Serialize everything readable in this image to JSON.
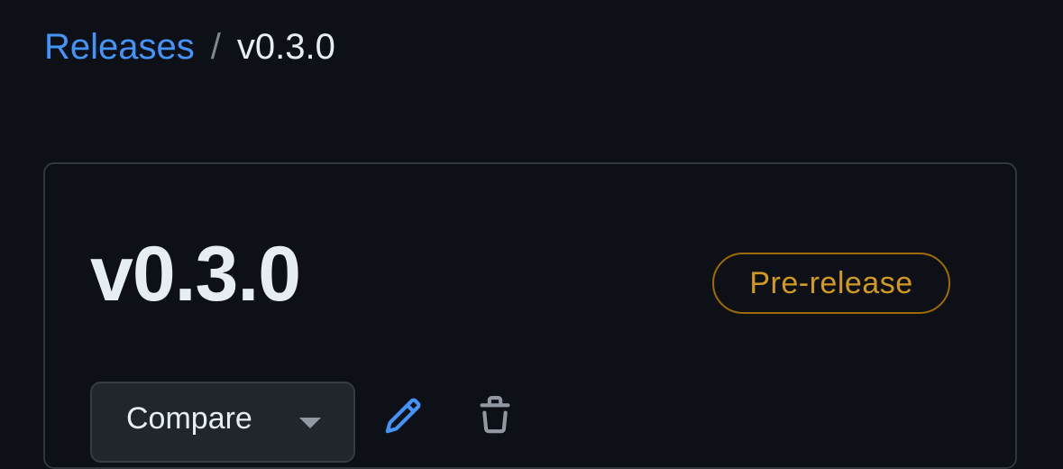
{
  "breadcrumb": {
    "link_label": "Releases",
    "separator": "/",
    "current": "v0.3.0"
  },
  "release": {
    "title": "v0.3.0",
    "badge": "Pre-release",
    "compare_label": "Compare"
  },
  "icons": {
    "caret": "triangle-down-icon",
    "edit": "pencil-icon",
    "delete": "trash-icon"
  },
  "colors": {
    "background": "#0d1117",
    "link": "#4493f8",
    "text": "#e6edf3",
    "muted": "#7d8590",
    "border": "#30363d",
    "prerelease": "#d29922",
    "prerelease_border": "#9e6a03",
    "button_bg": "#21262d"
  }
}
